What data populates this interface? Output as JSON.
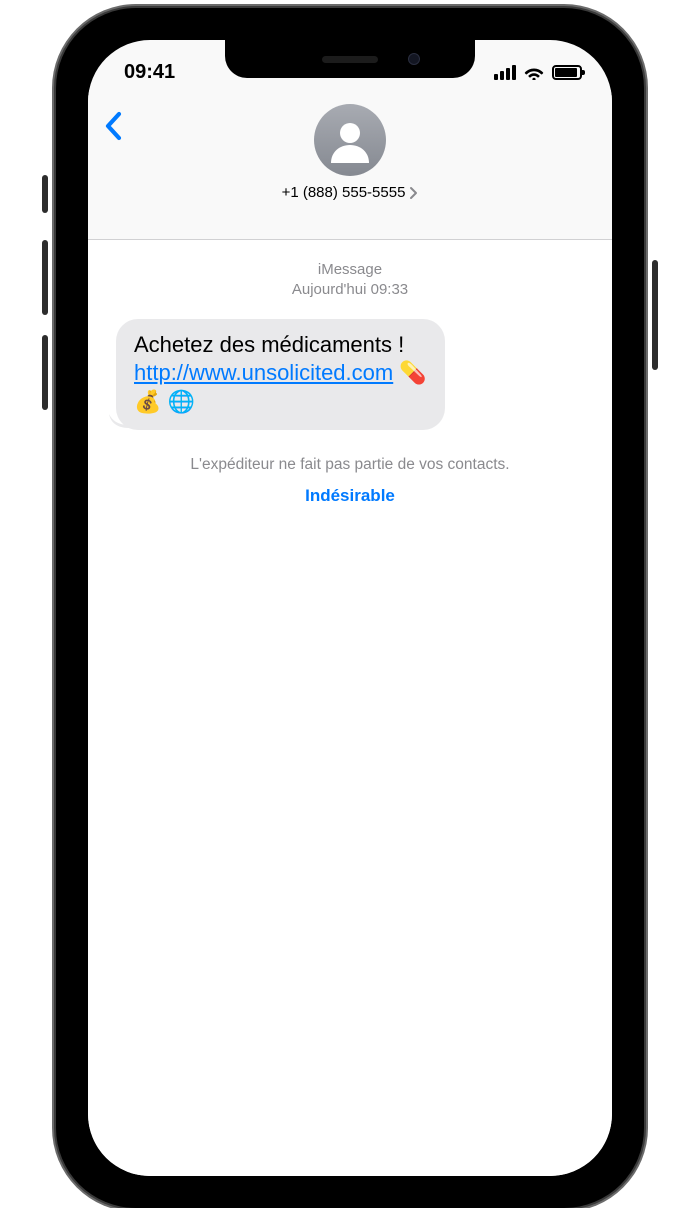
{
  "status_bar": {
    "time": "09:41"
  },
  "header": {
    "contact_number": "+1 (888) 555-5555"
  },
  "conversation": {
    "service_label": "iMessage",
    "date_prefix": "Aujourd'hui",
    "time": "09:33",
    "message": {
      "line1_text": "Achetez des médicaments !",
      "link_text": "http://www.unsolicited.com",
      "emoji_pill": "💊",
      "emoji_money": "💰",
      "emoji_globe": "🌐"
    },
    "unknown_sender_text": "L'expéditeur ne fait pas partie de vos contacts.",
    "report_junk_label": "Indésirable"
  }
}
